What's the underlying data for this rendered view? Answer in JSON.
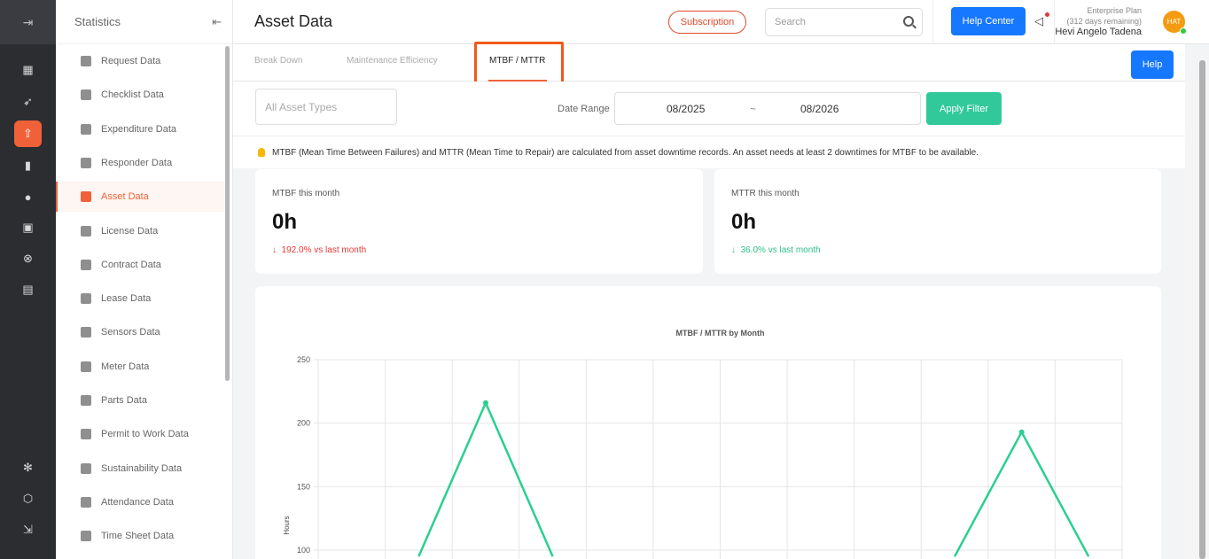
{
  "sidebar": {
    "title": "Statistics",
    "items": [
      {
        "label": "Request Data"
      },
      {
        "label": "Checklist Data"
      },
      {
        "label": "Expenditure Data"
      },
      {
        "label": "Responder Data"
      },
      {
        "label": "Asset Data",
        "active": true
      },
      {
        "label": "License Data"
      },
      {
        "label": "Contract Data"
      },
      {
        "label": "Lease Data"
      },
      {
        "label": "Sensors Data"
      },
      {
        "label": "Meter Data"
      },
      {
        "label": "Parts Data"
      },
      {
        "label": "Permit to Work Data"
      },
      {
        "label": "Sustainability Data"
      },
      {
        "label": "Attendance Data"
      },
      {
        "label": "Time Sheet Data"
      }
    ]
  },
  "header": {
    "title": "Asset Data",
    "subscription_label": "Subscription",
    "search_placeholder": "Search",
    "help_center_label": "Help Center",
    "plan_name": "Enterprise Plan",
    "plan_remaining": "(312 days remaining)",
    "user_name": "Hevi Angelo Tadena",
    "avatar_initials": "HAT"
  },
  "tabs": {
    "items": [
      {
        "label": "Break Down"
      },
      {
        "label": "Maintenance Efficiency"
      },
      {
        "label": "MTBF / MTTR",
        "active": true
      }
    ],
    "help_label": "Help"
  },
  "filters": {
    "asset_types_placeholder": "All Asset Types",
    "date_range_label": "Date Range",
    "date_from": "08/2025",
    "date_separator": "~",
    "date_to": "08/2026",
    "apply_label": "Apply Filter"
  },
  "note": "MTBF (Mean Time Between Failures) and MTTR (Mean Time to Repair) are calculated from asset downtime records. An asset needs at least 2 downtimes for MTBF to be available.",
  "cards": {
    "mtbf": {
      "label": "MTBF this month",
      "value": "0h",
      "change": "192.0% vs last month",
      "direction": "down"
    },
    "mttr": {
      "label": "MTTR this month",
      "value": "0h",
      "change": "36.0% vs last month",
      "direction": "down"
    }
  },
  "colors": {
    "accent": "#f0613a",
    "primary": "#1677ff",
    "success": "#32c99a",
    "series": "#2bcf8f"
  },
  "chart_data": {
    "type": "line",
    "title": "MTBF / MTTR by Month",
    "ylabel": "Hours",
    "yticks": [
      100,
      150,
      200,
      250
    ],
    "ylim": [
      100,
      250
    ],
    "series": [
      {
        "x": [
          2,
          3,
          4,
          10,
          11,
          12
        ],
        "values": [
          95,
          216,
          95,
          95,
          193,
          95
        ]
      }
    ],
    "x_slots": 12
  }
}
